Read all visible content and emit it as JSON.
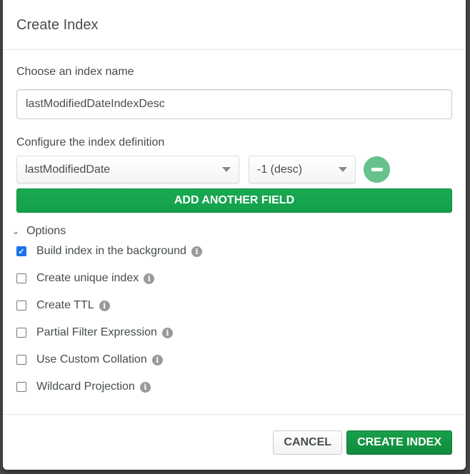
{
  "dialog": {
    "title": "Create Index"
  },
  "name_section": {
    "label": "Choose an index name",
    "value": "lastModifiedDateIndexDesc"
  },
  "definition": {
    "label": "Configure the index definition",
    "field": "lastModifiedDate",
    "direction": "-1 (desc)",
    "add_label": "ADD ANOTHER FIELD"
  },
  "options": {
    "label": "Options",
    "items": [
      {
        "label": "Build index in the background",
        "checked": true
      },
      {
        "label": "Create unique index",
        "checked": false
      },
      {
        "label": "Create TTL",
        "checked": false
      },
      {
        "label": "Partial Filter Expression",
        "checked": false
      },
      {
        "label": "Use Custom Collation",
        "checked": false
      },
      {
        "label": "Wildcard Projection",
        "checked": false
      }
    ]
  },
  "footer": {
    "cancel": "CANCEL",
    "create": "CREATE INDEX"
  },
  "colors": {
    "primary": "#13a04a",
    "checkbox": "#1a73e8"
  }
}
